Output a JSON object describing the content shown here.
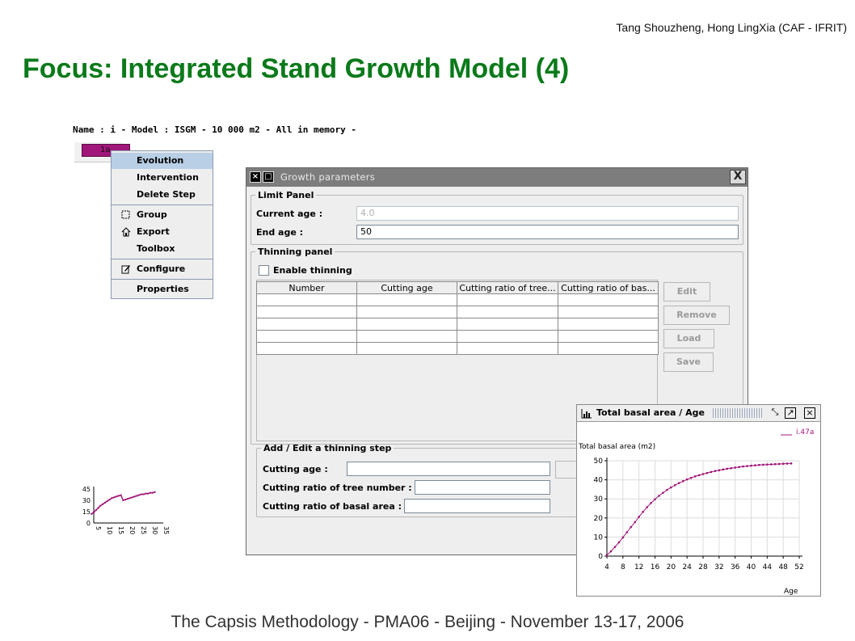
{
  "slide": {
    "authors": "Tang Shouzheng, Hong LingXia (CAF - IFRIT)",
    "title": "Focus: Integrated Stand Growth Model (4)",
    "footer": "The Capsis Methodology - PMA06 - Beijing - November 13-17, 2006"
  },
  "project": {
    "name_line": "Name : i - Model : ISGM - 10 000 m2 - All in memory -",
    "step_label": "1a"
  },
  "context_menu": {
    "items": [
      {
        "label": "Evolution",
        "icon": "",
        "selected": true
      },
      {
        "label": "Intervention",
        "icon": ""
      },
      {
        "label": "Delete Step",
        "icon": ""
      },
      {
        "label": "Group",
        "icon": "group-icon"
      },
      {
        "label": "Export",
        "icon": "export-icon"
      },
      {
        "label": "Toolbox",
        "icon": ""
      },
      {
        "label": "Configure",
        "icon": "configure-icon"
      },
      {
        "label": "Properties",
        "icon": ""
      }
    ]
  },
  "dialog": {
    "title": "Growth parameters",
    "limit_panel": {
      "legend": "Limit Panel",
      "current_age_label": "Current age :",
      "current_age_value": "4.0",
      "end_age_label": "End age :",
      "end_age_value": "50"
    },
    "thinning_panel": {
      "legend": "Thinning panel",
      "enable_label": "Enable thinning",
      "enable_checked": false,
      "columns": [
        "Number",
        "Cutting age",
        "Cutting ratio of tree...",
        "Cutting ratio of bas..."
      ],
      "buttons": {
        "edit": "Edit",
        "remove": "Remove",
        "load": "Load",
        "save": "Save"
      }
    },
    "add_edit_panel": {
      "legend": "Add / Edit a thinning step",
      "cutting_age_label": "Cutting age :",
      "cutting_ratio_tree_label": "Cutting ratio of tree number :",
      "cutting_ratio_basal_label": "Cutting ratio of basal area :"
    }
  },
  "mini_chart": {
    "chart_data": {
      "type": "line",
      "x": [
        4,
        5,
        6,
        7,
        8,
        9,
        10,
        11,
        12,
        13,
        14,
        15,
        16,
        17,
        18,
        19,
        20,
        21,
        22,
        23,
        24,
        25,
        26,
        27,
        28,
        29,
        30,
        31,
        32
      ],
      "y": [
        12,
        14,
        17,
        20,
        23,
        25,
        27,
        29,
        31,
        33,
        34,
        35,
        36,
        37,
        30,
        31,
        32,
        33,
        34,
        35,
        36,
        37,
        38,
        38,
        39,
        39,
        40,
        40,
        41
      ],
      "yticks": [
        "45",
        "30",
        "15",
        "0"
      ],
      "xticks": [
        "5",
        "10",
        "15",
        "20",
        "25",
        "30",
        "35"
      ],
      "xlim": [
        5,
        35
      ],
      "ylim": [
        0,
        45
      ]
    }
  },
  "chart_window": {
    "title": "Total basal area / Age",
    "legend": "i.47a",
    "series_color": "#a0167a",
    "chart_data": {
      "type": "line",
      "ylabel": "Total basal area (m2)",
      "xlabel": "Age",
      "xlim": [
        4,
        52
      ],
      "ylim": [
        0,
        50
      ],
      "xticks": [
        4,
        8,
        12,
        16,
        20,
        24,
        28,
        32,
        36,
        40,
        44,
        48,
        52
      ],
      "yticks": [
        0,
        10,
        20,
        30,
        40,
        50
      ],
      "series": [
        {
          "name": "i.47a",
          "x": [
            4,
            5,
            6,
            7,
            8,
            9,
            10,
            11,
            12,
            13,
            14,
            15,
            16,
            17,
            18,
            19,
            20,
            21,
            22,
            23,
            24,
            25,
            26,
            27,
            28,
            29,
            30,
            31,
            32,
            33,
            34,
            35,
            36,
            37,
            38,
            39,
            40,
            41,
            42,
            43,
            44,
            45,
            46,
            47,
            48,
            49,
            50
          ],
          "y": [
            0.5,
            2.5,
            4.8,
            7.2,
            9.8,
            12.5,
            15.2,
            17.8,
            20.6,
            23.2,
            25.6,
            27.8,
            29.8,
            31.6,
            33.2,
            34.7,
            36.0,
            37.2,
            38.3,
            39.3,
            40.2,
            41.0,
            41.8,
            42.4,
            43.0,
            43.6,
            44.1,
            44.6,
            45.0,
            45.4,
            45.8,
            46.1,
            46.4,
            46.7,
            47.0,
            47.2,
            47.4,
            47.6,
            47.8,
            47.9,
            48.0,
            48.1,
            48.2,
            48.3,
            48.4,
            48.5,
            48.6
          ]
        }
      ]
    }
  }
}
